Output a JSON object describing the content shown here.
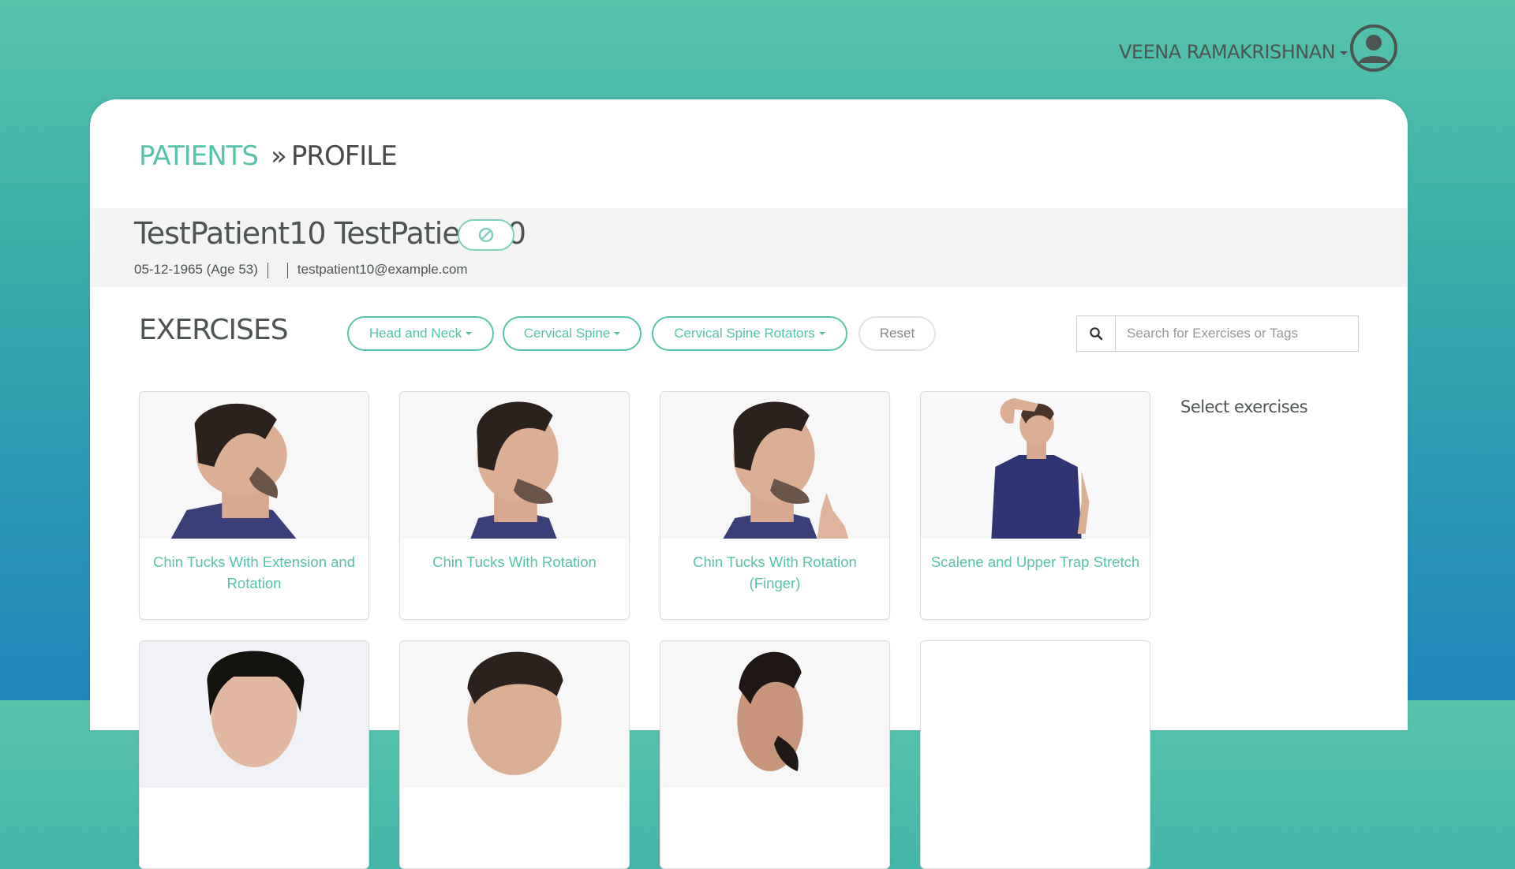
{
  "header": {
    "user_name": "VEENA RAMAKRISHNAN",
    "avatar_icon": "user-circle-icon"
  },
  "breadcrumb": {
    "parent": "PATIENTS",
    "separator": "»",
    "current": "PROFILE"
  },
  "patient": {
    "name": "TestPatient10 TestPatient10",
    "status_icon": "ban-icon",
    "dob_age": "05-12-1965 (Age 53)",
    "phone": "",
    "email": "testpatient10@example.com"
  },
  "exercises": {
    "title": "EXERCISES",
    "filters": [
      "Head and Neck",
      "Cervical Spine",
      "Cervical Spine Rotators"
    ],
    "reset_label": "Reset",
    "search_placeholder": "Search for Exercises or Tags",
    "search_icon": "search-icon",
    "select_label": "Select exercises",
    "cards": [
      {
        "title": "Chin Tucks With Extension and Rotation"
      },
      {
        "title": "Chin Tucks With Rotation"
      },
      {
        "title": "Chin Tucks With Rotation (Finger)"
      },
      {
        "title": "Scalene and Upper Trap Stretch"
      },
      {
        "title": ""
      },
      {
        "title": ""
      },
      {
        "title": ""
      },
      {
        "title": ""
      }
    ]
  },
  "colors": {
    "accent": "#57c3ab",
    "background_top": "#57c3ab",
    "background_bottom": "#1f86b9",
    "text": "#4d5552"
  }
}
